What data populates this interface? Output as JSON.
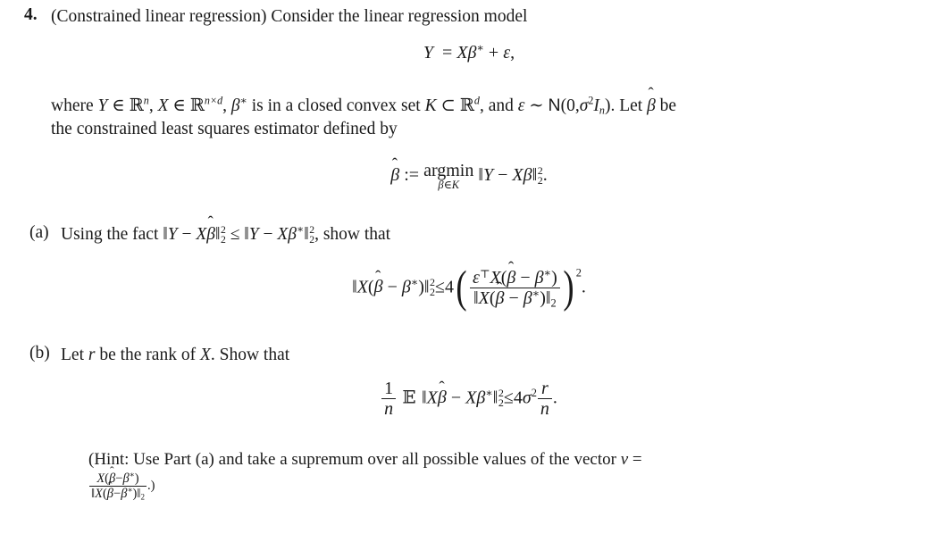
{
  "document": {
    "type": "homework-problem",
    "background_color": "#ffffff",
    "text_color": "#1a1a1a"
  },
  "problem": {
    "number": "4.",
    "title": "(Constrained linear regression)",
    "statement_lead": "Consider the linear regression model",
    "statement_full": "4. (Constrained linear regression) Consider the linear regression model"
  },
  "equations": {
    "model": {
      "latex": "Y = X\\beta^* + \\varepsilon,",
      "plain": "Y = Xβ* + ε,",
      "parts": {
        "lhs": "Y",
        "equals": "=",
        "X": "X",
        "beta_star": "β*",
        "plus": "+",
        "epsilon": "ε",
        "comma": ","
      }
    },
    "argmin": {
      "latex": "\\hat{\\beta} := \\operatorname*{argmin}_{\\beta \\in K} \\|Y - X\\beta\\|_2^2.",
      "plain": "β̂ := argmin_{β∈K} ||Y - Xβ||₂².",
      "parts": {
        "betahat": "β",
        "assign": ":=",
        "operator": "argmin",
        "operator_sub": "β∈K",
        "norm_open": "‖",
        "Y": "Y",
        "minus": "−",
        "Xbeta": "Xβ",
        "norm_close": "‖",
        "sup": "2",
        "sub": "2",
        "period": "."
      }
    },
    "part_a_display": {
      "latex": "\\|X(\\hat{\\beta}-\\beta^*)\\|_2^2 \\le 4\\left(\\frac{\\varepsilon^\\top X(\\hat{\\beta}-\\beta^*)}{\\|X(\\hat{\\beta}-\\beta^*)\\|_2}\\right)^2.",
      "plain": "||X(β̂−β*)||₂² ≤ 4( ε⊤X(β̂−β*) / ||X(β̂−β*)||₂ )².",
      "coefficient": "4",
      "relation": "≤",
      "outer_exponent": "2",
      "numerator_plain": "ε⊤X(β̂−β*)",
      "denominator_plain": "||X(β̂−β*)||₂",
      "period": "."
    },
    "part_b_display": {
      "latex": "\\frac{1}{n}\\mathbb{E}\\|X\\hat{\\beta}-X\\beta^*\\|_2^2 \\le 4\\sigma^2\\frac{r}{n}.",
      "plain": "(1/n) E||Xβ̂ − Xβ*||₂² ≤ 4σ² (r/n).",
      "lhs_frac_num": "1",
      "lhs_frac_den": "n",
      "expectation": "E",
      "relation": "≤",
      "coefficient": "4",
      "sigma": "σ",
      "sigma_exp": "2",
      "rhs_frac_num": "r",
      "rhs_frac_den": "n",
      "period": "."
    }
  },
  "paragraphs": {
    "where": {
      "line1": "where Y ∈ ℝⁿ, X ∈ ℝⁿˣᵈ, β* is in a closed convex set K ⊂ ℝᵈ, and ε ~ N(0,σ²Iₙ). Let β̂ be",
      "line2": "the constrained least squares estimator defined by",
      "tokens": {
        "where": "where",
        "Y": "Y",
        "in1": "∈",
        "Rn": "ℝ",
        "n_exp": "n",
        "comma1": ",",
        "X": "X",
        "in2": "∈",
        "Rnd_exp": "n×d",
        "comma2": ",",
        "beta_star": "β*",
        "phrase1": "is in a closed convex set",
        "K": "K",
        "subset": "⊂",
        "Rd_exp": "d",
        "comma3": ",",
        "and": "and",
        "epsilon": "ε",
        "sim": "∼",
        "normal": "N(0,",
        "sigma_sq": "σ",
        "I_n": "I",
        "close": ").",
        "let": "Let",
        "be": "be",
        "line2_text": "the constrained least squares estimator defined by"
      }
    }
  },
  "items": [
    {
      "label": "(a)",
      "text_lead": "Using the fact",
      "inline_fact_plain": "‖Y − Xβ̂‖₂² ≤ ‖Y − Xβ*‖₂²",
      "text_tail": ", show that",
      "full_plain": "(a) Using the fact ||Y − Xβ̂||₂² ≤ ||Y − Xβ*||₂², show that"
    },
    {
      "label": "(b)",
      "text_lead": "Let",
      "rank_var": "r",
      "text_mid": "be the rank of",
      "matrix_var": "X",
      "text_tail": ". Show that",
      "full_plain": "(b) Let r be the rank of X. Show that"
    }
  ],
  "hint": {
    "open_paren": "(Hint:",
    "text": "Use Part (a) and take a supremum over all possible values of the vector",
    "vector_var": "v",
    "equals": "=",
    "full_line1": "(Hint: Use Part (a) and take a supremum over all possible values of the vector v =",
    "frac_num_plain": "X(β̂−β*)",
    "frac_den_plain": "‖X(β̂−β*)‖₂",
    "trailer": ".)"
  },
  "symbols": {
    "hat": "ˆ",
    "beta": "β",
    "epsilon": "ε",
    "sigma": "σ",
    "transpose": "⊤",
    "leq": "≤",
    "minus": "−",
    "in": "∈",
    "subset": "⊂",
    "sim": "∼",
    "double_bar": "‖",
    "blackboard_R": "ℝ",
    "blackboard_E": "ᴇ"
  }
}
